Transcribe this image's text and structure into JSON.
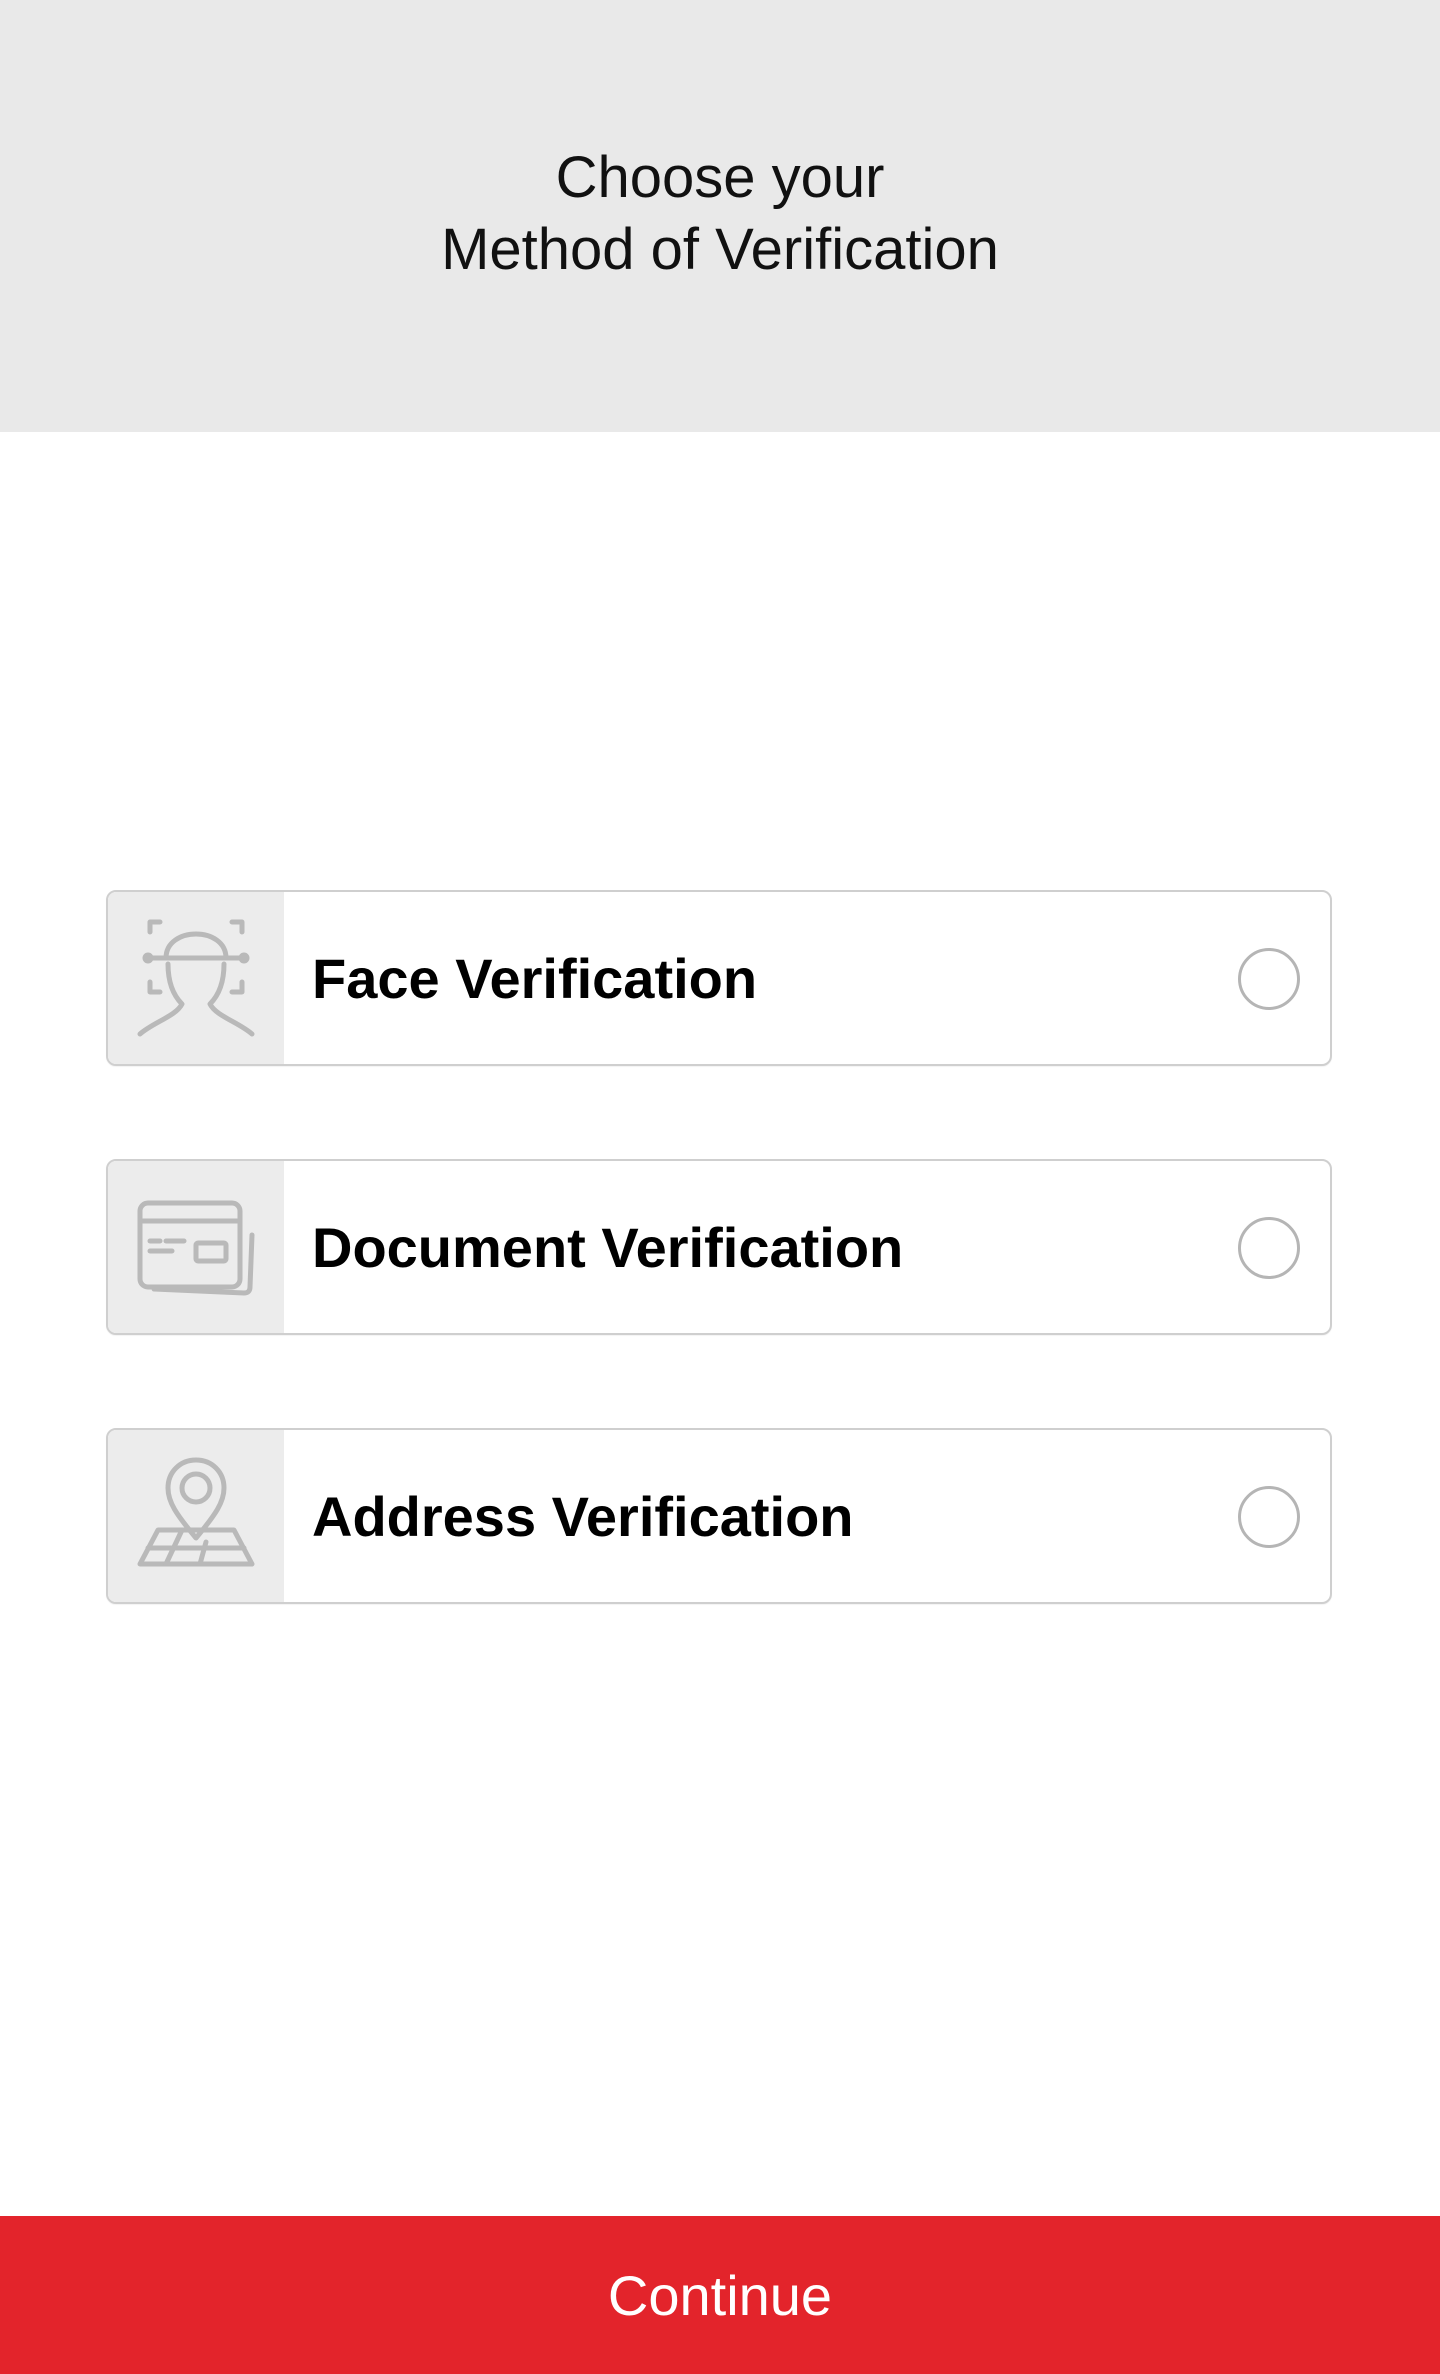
{
  "header": {
    "title_line1": "Choose your",
    "title_line2": "Method of Verification"
  },
  "options": [
    {
      "label": "Face Verification",
      "icon": "face-scan-icon",
      "selected": false
    },
    {
      "label": "Document Verification",
      "icon": "id-card-icon",
      "selected": false
    },
    {
      "label": "Address Verification",
      "icon": "map-pin-icon",
      "selected": false
    }
  ],
  "footer": {
    "continue_label": "Continue"
  },
  "colors": {
    "header_bg": "#e9e9e9",
    "accent": "#e3242b",
    "icon_gray": "#b5b5b5"
  }
}
